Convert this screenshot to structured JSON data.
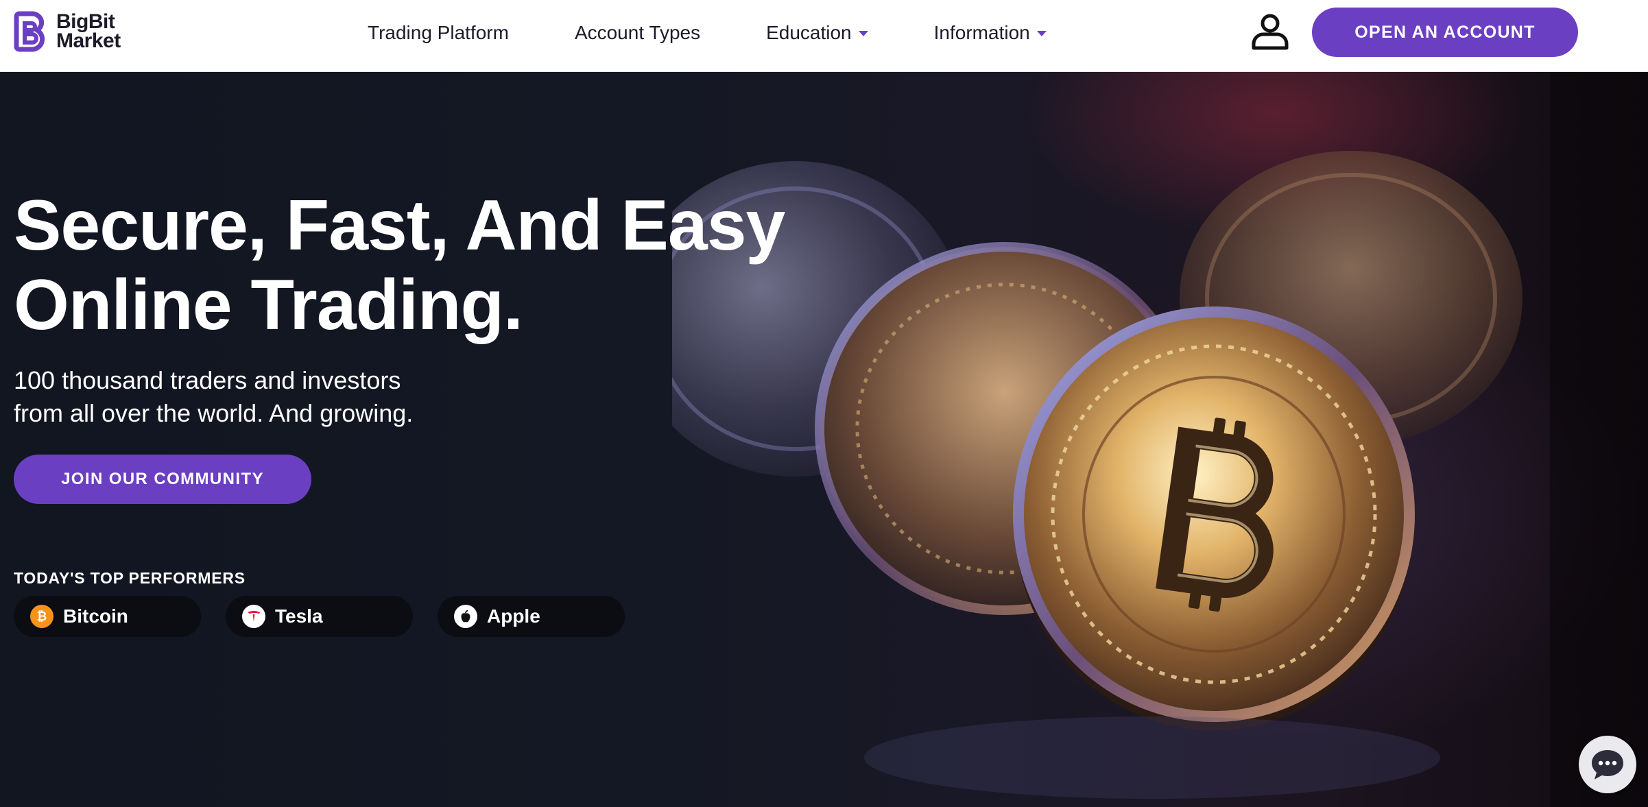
{
  "header": {
    "logo": {
      "line1": "BigBit",
      "line2": "Market"
    },
    "nav": [
      {
        "label": "Trading Platform",
        "has_dropdown": false
      },
      {
        "label": "Account Types",
        "has_dropdown": false
      },
      {
        "label": "Education",
        "has_dropdown": true
      },
      {
        "label": "Information",
        "has_dropdown": true
      }
    ],
    "user_icon": "user-icon",
    "open_account_label": "OPEN AN ACCOUNT"
  },
  "hero": {
    "headline_line1": "Secure, Fast, And Easy",
    "headline_line2": "Online Trading.",
    "subline_line1": "100 thousand traders and investors",
    "subline_line2": "from all over the world. And growing.",
    "join_label": "JOIN OUR COMMUNITY",
    "background_image": "bitcoin-coins"
  },
  "top_performers": {
    "title": "TODAY'S TOP PERFORMERS",
    "items": [
      {
        "label": "Bitcoin",
        "icon": "bitcoin-icon"
      },
      {
        "label": "Tesla",
        "icon": "tesla-icon"
      },
      {
        "label": "Apple",
        "icon": "apple-icon"
      }
    ]
  },
  "chat": {
    "icon": "chat-icon"
  },
  "colors": {
    "accent": "#6b3fc2",
    "header_bg": "#ffffff",
    "hero_bg": "#131722",
    "pill_bg": "#0b0d13",
    "bitcoin": "#f7931a",
    "tesla": "#e31937"
  }
}
